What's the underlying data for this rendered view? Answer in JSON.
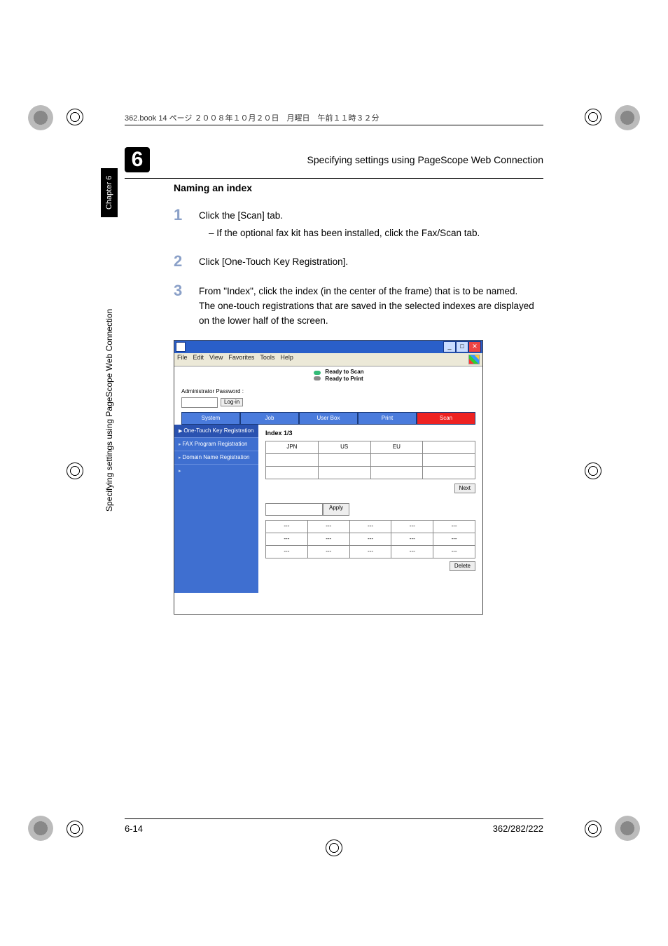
{
  "bookline": "362.book  14 ページ  ２００８年１０月２０日　月曜日　午前１１時３２分",
  "chapter_number": "6",
  "header_title": "Specifying settings using PageScope Web Connection",
  "side_tab": "Chapter 6",
  "side_text": "Specifying settings using PageScope Web Connection",
  "section_title": "Naming an index",
  "steps": {
    "s1_num": "1",
    "s1_text": "Click the [Scan] tab.",
    "s1_sub": "–   If the optional fax kit has been installed, click the Fax/Scan tab.",
    "s2_num": "2",
    "s2_text": "Click [One-Touch Key Registration].",
    "s3_num": "3",
    "s3_text": "From \"Index\", click the index (in the center of the frame) that is to be named.",
    "s3_text2": "The one-touch registrations that are saved in the selected indexes are displayed on the lower half of the screen."
  },
  "screenshot": {
    "menu": {
      "file": "File",
      "edit": "Edit",
      "view": "View",
      "fav": "Favorites",
      "tools": "Tools",
      "help": "Help"
    },
    "status1": "Ready to Scan",
    "status2": "Ready to Print",
    "admin_label": "Administrator Password :",
    "login_btn": "Log-in",
    "tabs": {
      "system": "System",
      "job": "Job",
      "userbox": "User Box",
      "print": "Print",
      "scan": "Scan"
    },
    "nav": {
      "one": "One-Touch Key Registration",
      "fax": "FAX Program Registration",
      "dom": "Domain Name Registration"
    },
    "index_title": "Index 1/3",
    "cells": {
      "jpn": "JPN",
      "us": "US",
      "eu": "EU"
    },
    "next_btn": "Next",
    "apply_btn": "Apply",
    "delete_btn": "Delete",
    "dash": "---"
  },
  "footer": {
    "left": "6-14",
    "right": "362/282/222"
  }
}
